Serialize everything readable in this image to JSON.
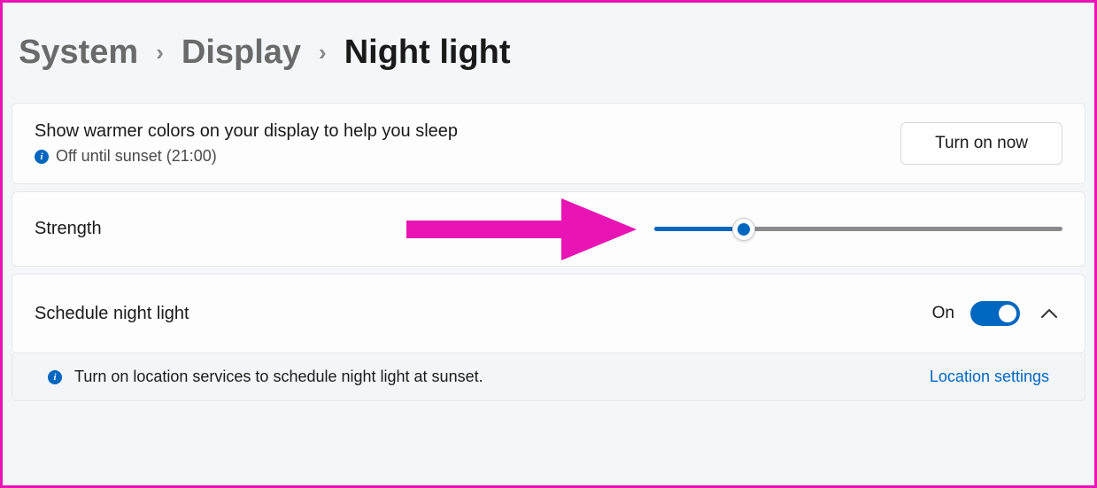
{
  "breadcrumb": {
    "system": "System",
    "display": "Display",
    "current": "Night light"
  },
  "header": {
    "description": "Show warmer colors on your display to help you sleep",
    "status": "Off until sunset (21:00)",
    "turn_on_label": "Turn on now"
  },
  "strength": {
    "label": "Strength",
    "value_percent": 22
  },
  "schedule": {
    "label": "Schedule night light",
    "state_label": "On",
    "enabled": true
  },
  "location_notice": {
    "message": "Turn on location services to schedule night light at sunset.",
    "link_label": "Location settings"
  },
  "colors": {
    "accent": "#0067c0",
    "annotation": "#e815b4"
  }
}
